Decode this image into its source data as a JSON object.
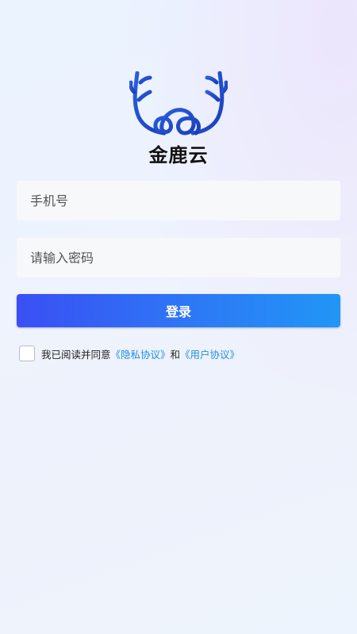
{
  "app": {
    "name": "金鹿云"
  },
  "form": {
    "phone_placeholder": "手机号",
    "password_placeholder": "请输入密码",
    "login_label": "登录"
  },
  "agreement": {
    "prefix": "我已阅读并同意",
    "privacy_link": "《隐私协议》",
    "conjunction": "和",
    "user_link": "《用户协议》",
    "checked": false
  },
  "colors": {
    "brand_blue": "#1f4fd0",
    "button_start": "#3a4ff4",
    "button_end": "#2196f6",
    "link": "#1e8fe0"
  },
  "icons": {
    "logo": "deer-antler-cloud-logo-icon"
  }
}
